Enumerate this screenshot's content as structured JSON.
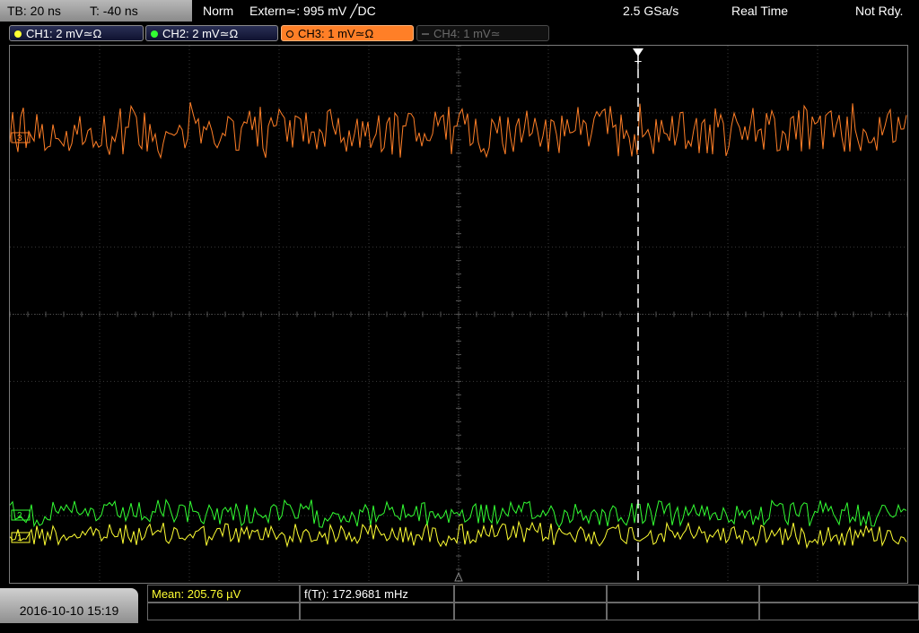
{
  "topbar": {
    "timebase": "TB: 20 ns",
    "trigger_time": "T: -40 ns",
    "mode": "Norm",
    "trigger_source": "Extern≃: 995 mV ╱DC",
    "sample_rate": "2.5 GSa/s",
    "acq_mode": "Real Time",
    "status": "Not Rdy."
  },
  "channels": [
    {
      "label": "CH1: 2 mV≃Ω",
      "color": "#ffff33",
      "state": "on"
    },
    {
      "label": "CH2: 2 mV≃Ω",
      "color": "#33ff33",
      "state": "on"
    },
    {
      "label": "CH3: 1 mV≃Ω",
      "color": "#ff7f27",
      "state": "active"
    },
    {
      "label": "CH4: 1 mV≃",
      "color": "#555555",
      "state": "off"
    }
  ],
  "markers": {
    "ch3": "3",
    "ch2": "2",
    "ch1": "1",
    "trigger": "T"
  },
  "measurements": {
    "mean": "Mean: 205.76 µV",
    "freq": "f(Tr): 172.9681 mHz"
  },
  "datetime": "2016-10-10 15:19"
}
